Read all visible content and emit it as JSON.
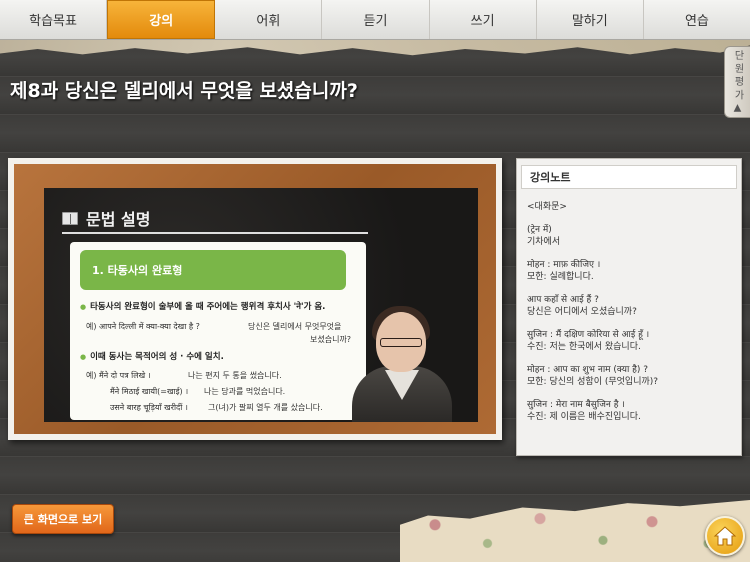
{
  "tabs": [
    {
      "label": "학습목표",
      "active": false
    },
    {
      "label": "강의",
      "active": true
    },
    {
      "label": "어휘",
      "active": false
    },
    {
      "label": "듣기",
      "active": false
    },
    {
      "label": "쓰기",
      "active": false
    },
    {
      "label": "말하기",
      "active": false
    },
    {
      "label": "연습",
      "active": false
    }
  ],
  "page_title": "제8과 당신은 델리에서 무엇을 보셨습니까?",
  "side_tab": "단 원 평 가 ▲",
  "slide": {
    "heading": "문법 설명",
    "banner": "1. 타동사의 완료형",
    "bullet1": "타동사의 완료형이 술부에 올 때 주어에는 행위격 후치사 'ने'가 옴.",
    "ex1_hi": "예) आपने दिल्ली में क्या-क्या देखा है ?",
    "ex1_ko": "당신은 델리에서 무엇무엇을",
    "ex1_ko2": "보셨습니까?",
    "bullet2": "이때 동사는 목적어의 성 · 수에 일치.",
    "ex2_hi": "예) मैंने दो पत्र लिखे ।",
    "ex2_ko": "나는 편지 두 통을 썼습니다.",
    "ex3_hi": "मैंने मिठाई खायी(=खाई) ।",
    "ex3_ko": "나는 당과를 먹었습니다.",
    "ex4_hi": "उसने बारह चूड़ियाँ खरीदीं ।",
    "ex4_ko": "그(녀)가 팔찌 열두 개를 샀습니다."
  },
  "notes": {
    "title": "강의노트",
    "lines": [
      "<대화문>",
      "",
      "(ट्रेन में)",
      "기차에서",
      "",
      "मोहन : माफ़ कीजिए ।",
      "모한: 실례합니다.",
      "",
      "आप कहाँ से आई हैं ?",
      "당신은 어디에서 오셨습니까?",
      "",
      "सुजिन : मैं दक्षिण कोरिया से आई हूँ ।",
      "수진: 저는 한국에서 왔습니다.",
      "",
      "मोहन : आप का शुभ नाम (क्या है) ?",
      "모한: 당신의 성함이 (무엇입니까)?",
      "",
      "सुजिन : मेरा नाम बैसुजिन है ।",
      "수진: 제 이름은 배수진입니다."
    ]
  },
  "big_screen_button": "큰 화면으로 보기",
  "icons": {
    "home": "home-icon",
    "slide": "book-icon"
  },
  "colors": {
    "accent": "#f0a020",
    "button": "#e97a22",
    "slide_green": "#7ab648"
  }
}
